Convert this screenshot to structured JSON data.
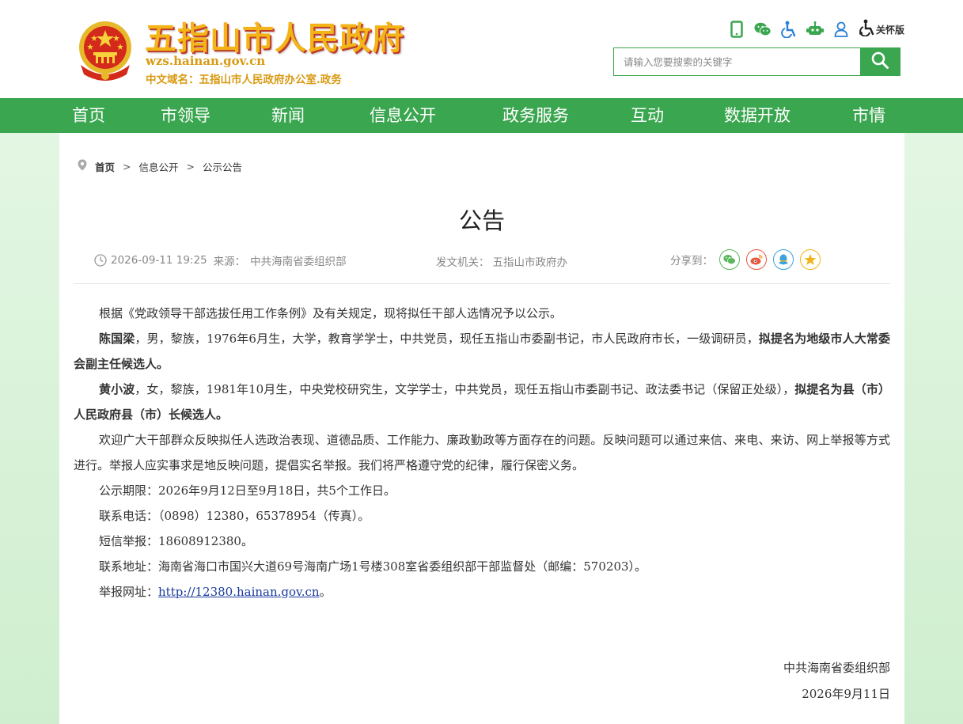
{
  "header": {
    "site_title": "五指山市人民政府",
    "domain": "wzs.hainan.gov.cn",
    "cn_domain": "中文域名：五指山市人民政府办公室.政务",
    "care_label": "关怀版",
    "search_placeholder": "请输入您要搜索的关键字",
    "icons": [
      "mobile-icon",
      "wechat-icon",
      "accessibility-icon",
      "robot-icon",
      "user-icon",
      "care-mode-icon",
      "search-icon"
    ],
    "accent_color": "#3aa64f",
    "title_color": "#f2b417"
  },
  "nav": {
    "items": [
      "首页",
      "市领导",
      "新闻",
      "信息公开",
      "政务服务",
      "互动",
      "数据开放",
      "市情"
    ]
  },
  "breadcrumb": {
    "home": "首页",
    "level1": "信息公开",
    "level2": "公示公告",
    "separator": ">"
  },
  "article": {
    "title": "公告",
    "datetime": "2026-09-11 19:25",
    "source_label": "来源：",
    "source": "中共海南省委组织部",
    "issuer_label": "发文机关：",
    "issuer": "五指山市政府办",
    "share_label": "分享到：",
    "share_icons": [
      "wechat-share-icon",
      "weibo-share-icon",
      "qq-share-icon",
      "qzone-share-icon"
    ],
    "intro": "根据《党政领导干部选拔任用工作条例》及有关规定，现将拟任干部人选情况予以公示。",
    "candidate1_name": "陈国梁",
    "candidate1_info": "，男，黎族，1976年6月生，大学，教育学学士，中共党员，现任五指山市委副书记，市人民政府市长，一级调研员，",
    "candidate1_role": "拟提名为地级市人大常委会副主任候选人。",
    "candidate2_name": "黄小波",
    "candidate2_info": "，女，黎族，1981年10月生，中央党校研究生，文学学士，中共党员，现任五指山市委副书记、政法委书记（保留正处级），",
    "candidate2_role": "拟提名为县（市）人民政府县（市）长候选人。",
    "feedback": "欢迎广大干部群众反映拟任人选政治表现、道德品质、工作能力、廉政勤政等方面存在的问题。反映问题可以通过来信、来电、来访、网上举报等方式进行。举报人应实事求是地反映问题，提倡实名举报。我们将严格遵守党的纪律，履行保密义务。",
    "period": "公示期限：2026年9月12日至9月18日，共5个工作日。",
    "phone": "联系电话：（0898）12380，65378954（传真）。",
    "sms": "短信举报：18608912380。",
    "address": "联系地址：海南省海口市国兴大道69号海南广场1号楼308室省委组织部干部监督处（邮编：570203）。",
    "report_label": "举报网址：",
    "report_url": "http://12380.hainan.gov.cn",
    "report_end": "。",
    "sign_org": "中共海南省委组织部",
    "sign_date": "2026年9月11日"
  }
}
